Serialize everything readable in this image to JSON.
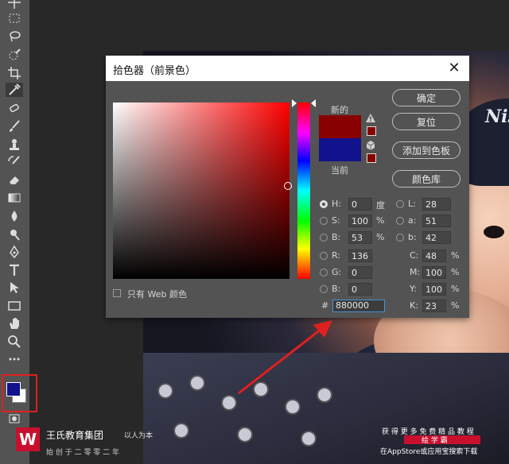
{
  "dialog": {
    "title": "拾色器（前景色）",
    "close": "✕",
    "new_label": "新的",
    "current_label": "当前",
    "buttons": {
      "ok": "确定",
      "reset": "复位",
      "add_swatch": "添加到色板",
      "color_libraries": "颜色库"
    },
    "web_only_label": "只有 Web 颜色",
    "fields": {
      "H": {
        "label": "H:",
        "value": "0",
        "unit": "度"
      },
      "S": {
        "label": "S:",
        "value": "100",
        "unit": "%"
      },
      "Bv": {
        "label": "B:",
        "value": "53",
        "unit": "%"
      },
      "R": {
        "label": "R:",
        "value": "136"
      },
      "G": {
        "label": "G:",
        "value": "0"
      },
      "Bc": {
        "label": "B:",
        "value": "0"
      },
      "L": {
        "label": "L:",
        "value": "28"
      },
      "a": {
        "label": "a:",
        "value": "51"
      },
      "b": {
        "label": "b:",
        "value": "42"
      },
      "C": {
        "label": "C:",
        "value": "48",
        "unit": "%"
      },
      "M": {
        "label": "M:",
        "value": "100",
        "unit": "%"
      },
      "Y": {
        "label": "Y:",
        "value": "100",
        "unit": "%"
      },
      "K": {
        "label": "K:",
        "value": "23",
        "unit": "%"
      }
    },
    "hex_label": "#",
    "hex_value": "880000",
    "new_color": "#880000",
    "current_color": "#12128c"
  },
  "toolbar": {
    "foreground_color": "#12128c",
    "background_color": "#ffffff"
  },
  "watermark": {
    "logo": "W",
    "brand_name": "王氏教育集团",
    "brand_slogan": "以人为本",
    "brand_tagline": "始 创 于 二 零 零 二 年",
    "right_line1": "获 得 更 多 免 费 精 品 教 程",
    "right_badge": "绘 学 霸",
    "right_line3": "在AppStore或应用宝搜索下载"
  },
  "photo": {
    "cap_mark": "Nisho"
  }
}
